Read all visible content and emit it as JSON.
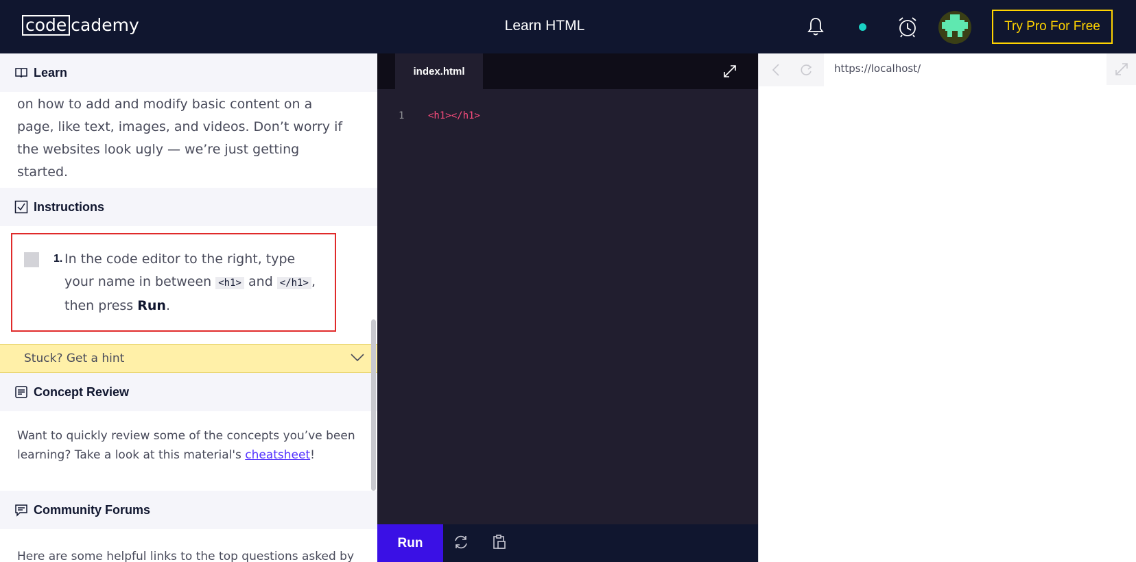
{
  "header": {
    "logo_part1": "code",
    "logo_part2": "cademy",
    "course_title": "Learn HTML",
    "pro_button": "Try Pro For Free",
    "icons": [
      "bell-icon",
      "status-dot",
      "alarm-clock-icon",
      "avatar"
    ]
  },
  "lesson": {
    "learn_heading": "Learn",
    "learn_text": "on how to add and modify basic content on a page, like text, images, and videos. Don’t worry if the websites look ugly — we’re just getting started.",
    "instructions_heading": "Instructions",
    "instruction": {
      "number": "1.",
      "text_a": "In the code editor to the right, type your name in between ",
      "code_a": "<h1>",
      "text_b": " and ",
      "code_b": "</h1>",
      "text_c": ", then press ",
      "bold": "Run",
      "text_d": "."
    },
    "hint_label": "Stuck? Get a hint",
    "concept_heading": "Concept Review",
    "concept_text": "Want to quickly review some of the concepts you’ve been learning? Take a look at this material's ",
    "concept_link": "cheatsheet",
    "concept_end": "!",
    "forums_heading": "Community Forums",
    "forums_text": "Here are some helpful links to the top questions asked by"
  },
  "editor": {
    "file_tab": "index.html",
    "line_numbers": [
      "1"
    ],
    "code_lines": [
      "<h1></h1>"
    ],
    "run_label": "Run"
  },
  "browser": {
    "url": "https://localhost/"
  },
  "colors": {
    "header_bg": "#10162f",
    "pro_yellow": "#ffd300",
    "run_purple": "#3a10e5",
    "editor_bg": "#211e2f",
    "code_pink": "#ff4d7e",
    "hint_bg": "#fff0a8",
    "highlight_border": "#e02a2a"
  }
}
